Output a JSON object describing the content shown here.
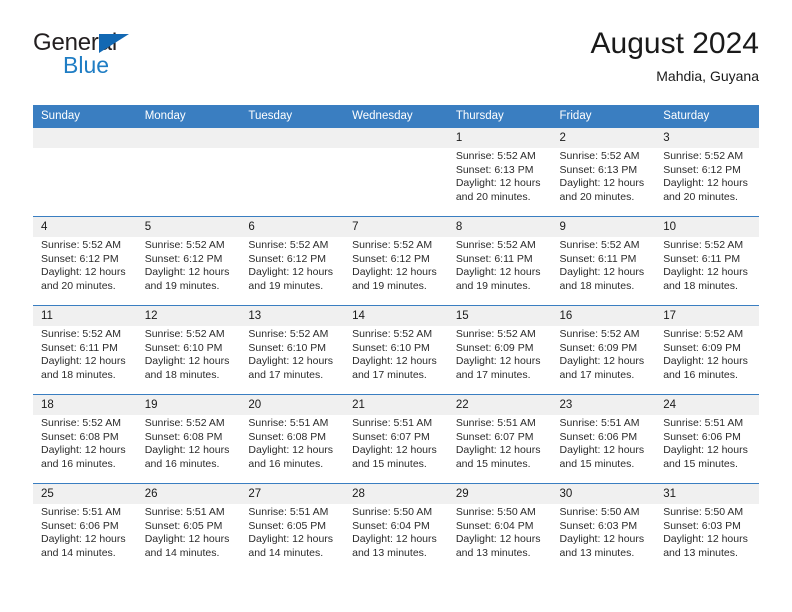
{
  "brand": {
    "name_top": "General",
    "name_bottom": "Blue",
    "triangle_color": "#1268b3",
    "blue_text_color": "#1f7dc4"
  },
  "header": {
    "title": "August 2024",
    "subtitle": "Mahdia, Guyana"
  },
  "theme": {
    "header_row_bg": "#3a7ec1",
    "header_row_text": "#ffffff",
    "daynum_bg": "#f0f0f0",
    "cell_border": "#3a7ec1",
    "body_text": "#2b2b2b"
  },
  "weekday_headers": [
    "Sunday",
    "Monday",
    "Tuesday",
    "Wednesday",
    "Thursday",
    "Friday",
    "Saturday"
  ],
  "labels": {
    "sunrise_prefix": "Sunrise:",
    "sunset_prefix": "Sunset:",
    "daylight_prefix": "Daylight:"
  },
  "weeks": [
    [
      {
        "day": "",
        "empty": true
      },
      {
        "day": "",
        "empty": true
      },
      {
        "day": "",
        "empty": true
      },
      {
        "day": "",
        "empty": true
      },
      {
        "day": "1",
        "sunrise": "Sunrise: 5:52 AM",
        "sunset": "Sunset: 6:13 PM",
        "daylight_1": "Daylight: 12 hours",
        "daylight_2": "and 20 minutes."
      },
      {
        "day": "2",
        "sunrise": "Sunrise: 5:52 AM",
        "sunset": "Sunset: 6:13 PM",
        "daylight_1": "Daylight: 12 hours",
        "daylight_2": "and 20 minutes."
      },
      {
        "day": "3",
        "sunrise": "Sunrise: 5:52 AM",
        "sunset": "Sunset: 6:12 PM",
        "daylight_1": "Daylight: 12 hours",
        "daylight_2": "and 20 minutes."
      }
    ],
    [
      {
        "day": "4",
        "sunrise": "Sunrise: 5:52 AM",
        "sunset": "Sunset: 6:12 PM",
        "daylight_1": "Daylight: 12 hours",
        "daylight_2": "and 20 minutes."
      },
      {
        "day": "5",
        "sunrise": "Sunrise: 5:52 AM",
        "sunset": "Sunset: 6:12 PM",
        "daylight_1": "Daylight: 12 hours",
        "daylight_2": "and 19 minutes."
      },
      {
        "day": "6",
        "sunrise": "Sunrise: 5:52 AM",
        "sunset": "Sunset: 6:12 PM",
        "daylight_1": "Daylight: 12 hours",
        "daylight_2": "and 19 minutes."
      },
      {
        "day": "7",
        "sunrise": "Sunrise: 5:52 AM",
        "sunset": "Sunset: 6:12 PM",
        "daylight_1": "Daylight: 12 hours",
        "daylight_2": "and 19 minutes."
      },
      {
        "day": "8",
        "sunrise": "Sunrise: 5:52 AM",
        "sunset": "Sunset: 6:11 PM",
        "daylight_1": "Daylight: 12 hours",
        "daylight_2": "and 19 minutes."
      },
      {
        "day": "9",
        "sunrise": "Sunrise: 5:52 AM",
        "sunset": "Sunset: 6:11 PM",
        "daylight_1": "Daylight: 12 hours",
        "daylight_2": "and 18 minutes."
      },
      {
        "day": "10",
        "sunrise": "Sunrise: 5:52 AM",
        "sunset": "Sunset: 6:11 PM",
        "daylight_1": "Daylight: 12 hours",
        "daylight_2": "and 18 minutes."
      }
    ],
    [
      {
        "day": "11",
        "sunrise": "Sunrise: 5:52 AM",
        "sunset": "Sunset: 6:11 PM",
        "daylight_1": "Daylight: 12 hours",
        "daylight_2": "and 18 minutes."
      },
      {
        "day": "12",
        "sunrise": "Sunrise: 5:52 AM",
        "sunset": "Sunset: 6:10 PM",
        "daylight_1": "Daylight: 12 hours",
        "daylight_2": "and 18 minutes."
      },
      {
        "day": "13",
        "sunrise": "Sunrise: 5:52 AM",
        "sunset": "Sunset: 6:10 PM",
        "daylight_1": "Daylight: 12 hours",
        "daylight_2": "and 17 minutes."
      },
      {
        "day": "14",
        "sunrise": "Sunrise: 5:52 AM",
        "sunset": "Sunset: 6:10 PM",
        "daylight_1": "Daylight: 12 hours",
        "daylight_2": "and 17 minutes."
      },
      {
        "day": "15",
        "sunrise": "Sunrise: 5:52 AM",
        "sunset": "Sunset: 6:09 PM",
        "daylight_1": "Daylight: 12 hours",
        "daylight_2": "and 17 minutes."
      },
      {
        "day": "16",
        "sunrise": "Sunrise: 5:52 AM",
        "sunset": "Sunset: 6:09 PM",
        "daylight_1": "Daylight: 12 hours",
        "daylight_2": "and 17 minutes."
      },
      {
        "day": "17",
        "sunrise": "Sunrise: 5:52 AM",
        "sunset": "Sunset: 6:09 PM",
        "daylight_1": "Daylight: 12 hours",
        "daylight_2": "and 16 minutes."
      }
    ],
    [
      {
        "day": "18",
        "sunrise": "Sunrise: 5:52 AM",
        "sunset": "Sunset: 6:08 PM",
        "daylight_1": "Daylight: 12 hours",
        "daylight_2": "and 16 minutes."
      },
      {
        "day": "19",
        "sunrise": "Sunrise: 5:52 AM",
        "sunset": "Sunset: 6:08 PM",
        "daylight_1": "Daylight: 12 hours",
        "daylight_2": "and 16 minutes."
      },
      {
        "day": "20",
        "sunrise": "Sunrise: 5:51 AM",
        "sunset": "Sunset: 6:08 PM",
        "daylight_1": "Daylight: 12 hours",
        "daylight_2": "and 16 minutes."
      },
      {
        "day": "21",
        "sunrise": "Sunrise: 5:51 AM",
        "sunset": "Sunset: 6:07 PM",
        "daylight_1": "Daylight: 12 hours",
        "daylight_2": "and 15 minutes."
      },
      {
        "day": "22",
        "sunrise": "Sunrise: 5:51 AM",
        "sunset": "Sunset: 6:07 PM",
        "daylight_1": "Daylight: 12 hours",
        "daylight_2": "and 15 minutes."
      },
      {
        "day": "23",
        "sunrise": "Sunrise: 5:51 AM",
        "sunset": "Sunset: 6:06 PM",
        "daylight_1": "Daylight: 12 hours",
        "daylight_2": "and 15 minutes."
      },
      {
        "day": "24",
        "sunrise": "Sunrise: 5:51 AM",
        "sunset": "Sunset: 6:06 PM",
        "daylight_1": "Daylight: 12 hours",
        "daylight_2": "and 15 minutes."
      }
    ],
    [
      {
        "day": "25",
        "sunrise": "Sunrise: 5:51 AM",
        "sunset": "Sunset: 6:06 PM",
        "daylight_1": "Daylight: 12 hours",
        "daylight_2": "and 14 minutes."
      },
      {
        "day": "26",
        "sunrise": "Sunrise: 5:51 AM",
        "sunset": "Sunset: 6:05 PM",
        "daylight_1": "Daylight: 12 hours",
        "daylight_2": "and 14 minutes."
      },
      {
        "day": "27",
        "sunrise": "Sunrise: 5:51 AM",
        "sunset": "Sunset: 6:05 PM",
        "daylight_1": "Daylight: 12 hours",
        "daylight_2": "and 14 minutes."
      },
      {
        "day": "28",
        "sunrise": "Sunrise: 5:50 AM",
        "sunset": "Sunset: 6:04 PM",
        "daylight_1": "Daylight: 12 hours",
        "daylight_2": "and 13 minutes."
      },
      {
        "day": "29",
        "sunrise": "Sunrise: 5:50 AM",
        "sunset": "Sunset: 6:04 PM",
        "daylight_1": "Daylight: 12 hours",
        "daylight_2": "and 13 minutes."
      },
      {
        "day": "30",
        "sunrise": "Sunrise: 5:50 AM",
        "sunset": "Sunset: 6:03 PM",
        "daylight_1": "Daylight: 12 hours",
        "daylight_2": "and 13 minutes."
      },
      {
        "day": "31",
        "sunrise": "Sunrise: 5:50 AM",
        "sunset": "Sunset: 6:03 PM",
        "daylight_1": "Daylight: 12 hours",
        "daylight_2": "and 13 minutes."
      }
    ]
  ]
}
